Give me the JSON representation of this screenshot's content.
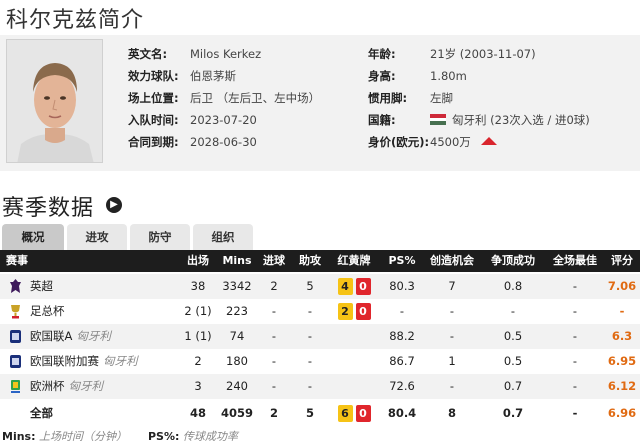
{
  "page": {
    "title": "科尔克兹简介",
    "section_title": "赛季数据"
  },
  "profile": {
    "rows": [
      {
        "label": "英文名:",
        "value": "Milos Kerkez"
      },
      {
        "label": "效力球队:",
        "value": "伯恩茅斯"
      },
      {
        "label": "场上位置:",
        "value": "后卫 （左后卫、左中场）"
      },
      {
        "label": "入队时间:",
        "value": "2023-07-20"
      },
      {
        "label": "合同到期:",
        "value": "2028-06-30"
      }
    ],
    "right": {
      "age_label": "年龄:",
      "age_value": "21岁 (2003-11-07)",
      "height_label": "身高:",
      "height_value": "1.80m",
      "foot_label": "惯用脚:",
      "foot_value": "左脚",
      "nation_label": "国籍:",
      "nation_value": "匈牙利 (23次入选 / 进0球)",
      "value_label": "身价(欧元):",
      "value_value": "4500万",
      "flag_colors": [
        "#ce2939",
        "#ffffff",
        "#477050"
      ],
      "trend_color": "#d9252d"
    }
  },
  "tabs": [
    "概况",
    "进攻",
    "防守",
    "组织"
  ],
  "table": {
    "headers": [
      "赛事",
      "出场",
      "Mins",
      "进球",
      "助攻",
      "红黄牌",
      "PS%",
      "创造机会",
      "争顶成功",
      "全场最佳",
      "评分"
    ],
    "rows": [
      {
        "comp": "英超",
        "team": "",
        "apps": "38",
        "mins": "3342",
        "goals": "2",
        "assists": "5",
        "yellow": "4",
        "red": "0",
        "ps": "80.3",
        "chances": "7",
        "aerial": "0.8",
        "motm": "-",
        "rating": "7.06",
        "logo": "premier-league-logo"
      },
      {
        "comp": "足总杯",
        "team": "",
        "apps": "2 (1)",
        "mins": "223",
        "goals": "-",
        "assists": "-",
        "yellow": "2",
        "red": "0",
        "ps": "-",
        "chances": "-",
        "aerial": "-",
        "motm": "-",
        "rating": "-",
        "logo": "fa-cup-logo"
      },
      {
        "comp": "欧国联A",
        "team": "匈牙利",
        "apps": "1 (1)",
        "mins": "74",
        "goals": "-",
        "assists": "-",
        "yellow": "",
        "red": "",
        "ps": "88.2",
        "chances": "-",
        "aerial": "0.5",
        "motm": "-",
        "rating": "6.3",
        "logo": "nations-league-logo"
      },
      {
        "comp": "欧国联附加赛",
        "team": "匈牙利",
        "apps": "2",
        "mins": "180",
        "goals": "-",
        "assists": "-",
        "yellow": "",
        "red": "",
        "ps": "86.7",
        "chances": "1",
        "aerial": "0.5",
        "motm": "-",
        "rating": "6.95",
        "logo": "nations-league-logo"
      },
      {
        "comp": "欧洲杯",
        "team": "匈牙利",
        "apps": "3",
        "mins": "240",
        "goals": "-",
        "assists": "-",
        "yellow": "",
        "red": "",
        "ps": "72.6",
        "chances": "-",
        "aerial": "0.7",
        "motm": "-",
        "rating": "6.12",
        "logo": "euro-logo"
      }
    ],
    "total": {
      "comp": "全部",
      "apps": "48",
      "mins": "4059",
      "goals": "2",
      "assists": "5",
      "yellow": "6",
      "red": "0",
      "ps": "80.4",
      "chances": "8",
      "aerial": "0.7",
      "motm": "-",
      "rating": "6.96"
    }
  },
  "legend": {
    "mins_key": "Mins:",
    "mins_desc": "上场时间（分钟）",
    "ps_key": "PS%:",
    "ps_desc": "传球成功率"
  }
}
